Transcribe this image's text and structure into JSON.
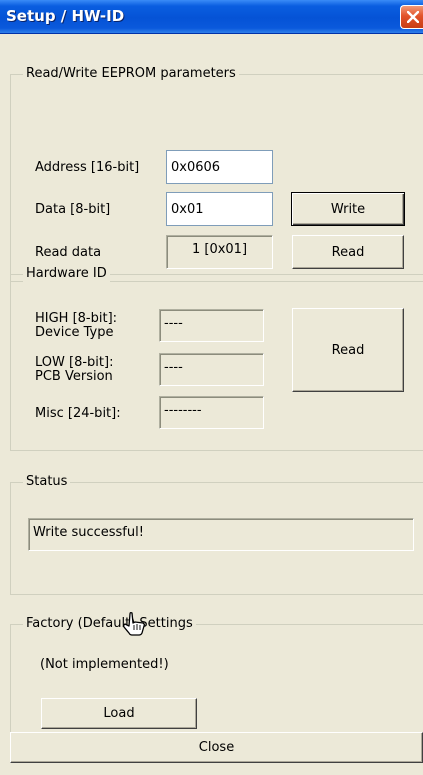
{
  "window": {
    "title": "Setup / HW-ID",
    "close_icon": "close-icon"
  },
  "eeprom": {
    "group_label": "Read/Write EEPROM parameters",
    "address_label": "Address [16-bit]",
    "address_value": "0x0606",
    "data_label": "Data [8-bit]",
    "data_value": "0x01",
    "write_button": "Write",
    "read_data_label": "Read data",
    "read_data_value": "1 [0x01]",
    "read_button": "Read"
  },
  "hardware": {
    "group_label": "Hardware ID",
    "high_label_line1": "HIGH [8-bit]:",
    "high_label_line2": "Device Type",
    "high_value": "----",
    "low_label_line1": "LOW [8-bit]:",
    "low_label_line2": "PCB Version",
    "low_value": "----",
    "misc_label": "Misc [24-bit]:",
    "misc_value": "--------",
    "read_button": "Read"
  },
  "status": {
    "group_label": "Status",
    "message": "Write successful!"
  },
  "factory": {
    "group_label": "Factory (Default) Settings",
    "note": "(Not implemented!)",
    "load_button": "Load"
  },
  "footer": {
    "close_button": "Close"
  },
  "colors": {
    "title_bar": "#0553d6",
    "close_button": "#e2532a",
    "window_bg": "#ece9d8"
  }
}
